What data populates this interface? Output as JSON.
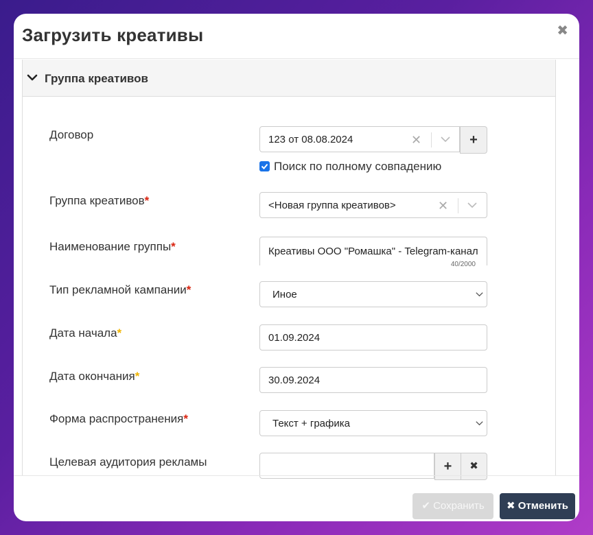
{
  "dialog": {
    "title": "Загрузить креативы",
    "close_icon": "close-icon"
  },
  "section": {
    "title": "Группа креативов",
    "expanded": true
  },
  "fields": {
    "contract": {
      "label": "Договор",
      "value": "123 от 08.08.2024",
      "exact_match_label": "Поиск по полному совпадению",
      "exact_match_checked": true,
      "add_glyph": "+"
    },
    "creative_group": {
      "label": "Группа креативов",
      "required": "*",
      "value": "<Новая группа креативов>"
    },
    "group_name": {
      "label": "Наименование группы",
      "required": "*",
      "value": "Креативы ООО \"Ромашка\" - Telegram-канал",
      "counter": "40/2000"
    },
    "campaign_type": {
      "label": "Тип рекламной кампании",
      "required": "*",
      "value": "Иное"
    },
    "start_date": {
      "label": "Дата начала",
      "required": "*",
      "value": "01.09.2024"
    },
    "end_date": {
      "label": "Дата окончания",
      "required": "*",
      "value": "30.09.2024"
    },
    "distribution_form": {
      "label": "Форма распространения",
      "required": "*",
      "value": "Текст + графика"
    },
    "target_audience": {
      "label": "Целевая аудитория рекламы",
      "value": "",
      "add_glyph": "+",
      "clear_glyph": "✖"
    }
  },
  "footer": {
    "save_label": "✔ Сохранить",
    "cancel_label": "✖ Отменить"
  },
  "colors": {
    "required_red": "#d9230f",
    "required_yellow": "#f0b400",
    "cancel_bg": "#2f3e55",
    "save_disabled_bg": "#d9d9d9",
    "checkbox": "#1a73e8"
  }
}
